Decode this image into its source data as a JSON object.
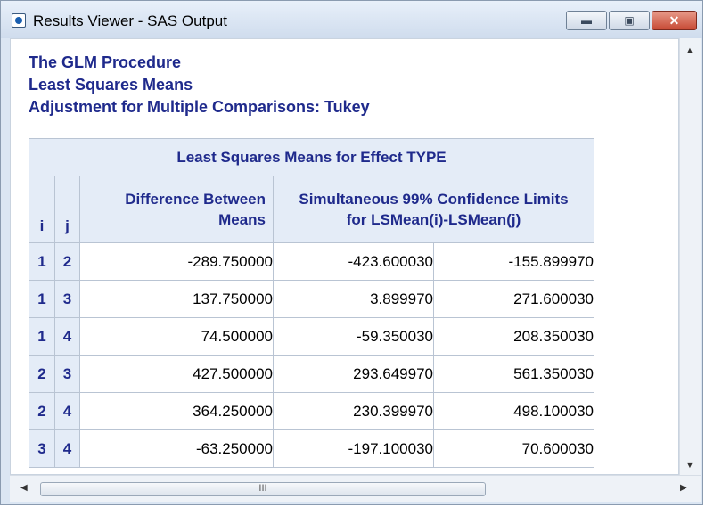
{
  "window": {
    "title": "Results Viewer - SAS Output",
    "minimize_icon": "minimize-icon",
    "maximize_icon": "maximize-icon",
    "close_icon": "close-icon"
  },
  "output": {
    "line1": "The GLM Procedure",
    "line2": "Least Squares Means",
    "line3": "Adjustment for Multiple Comparisons: Tukey"
  },
  "table": {
    "title": "Least Squares Means for Effect TYPE",
    "col_i": "i",
    "col_j": "j",
    "col_diff_1": "Difference Between",
    "col_diff_2": "Means",
    "col_ci_1": "Simultaneous 99% Confidence Limits",
    "col_ci_2": "for LSMean(i)-LSMean(j)",
    "rows": [
      {
        "i": "1",
        "j": "2",
        "diff": "-289.750000",
        "lower": "-423.600030",
        "upper": "-155.899970"
      },
      {
        "i": "1",
        "j": "3",
        "diff": "137.750000",
        "lower": "3.899970",
        "upper": "271.600030"
      },
      {
        "i": "1",
        "j": "4",
        "diff": "74.500000",
        "lower": "-59.350030",
        "upper": "208.350030"
      },
      {
        "i": "2",
        "j": "3",
        "diff": "427.500000",
        "lower": "293.649970",
        "upper": "561.350030"
      },
      {
        "i": "2",
        "j": "4",
        "diff": "364.250000",
        "lower": "230.399970",
        "upper": "498.100030"
      },
      {
        "i": "3",
        "j": "4",
        "diff": "-63.250000",
        "lower": "-197.100030",
        "upper": "70.600030"
      }
    ]
  },
  "scrollbar": {
    "thumb_grip": "III",
    "up_arrow": "▲",
    "down_arrow": "▼",
    "left_arrow": "◀",
    "right_arrow": "▶"
  }
}
